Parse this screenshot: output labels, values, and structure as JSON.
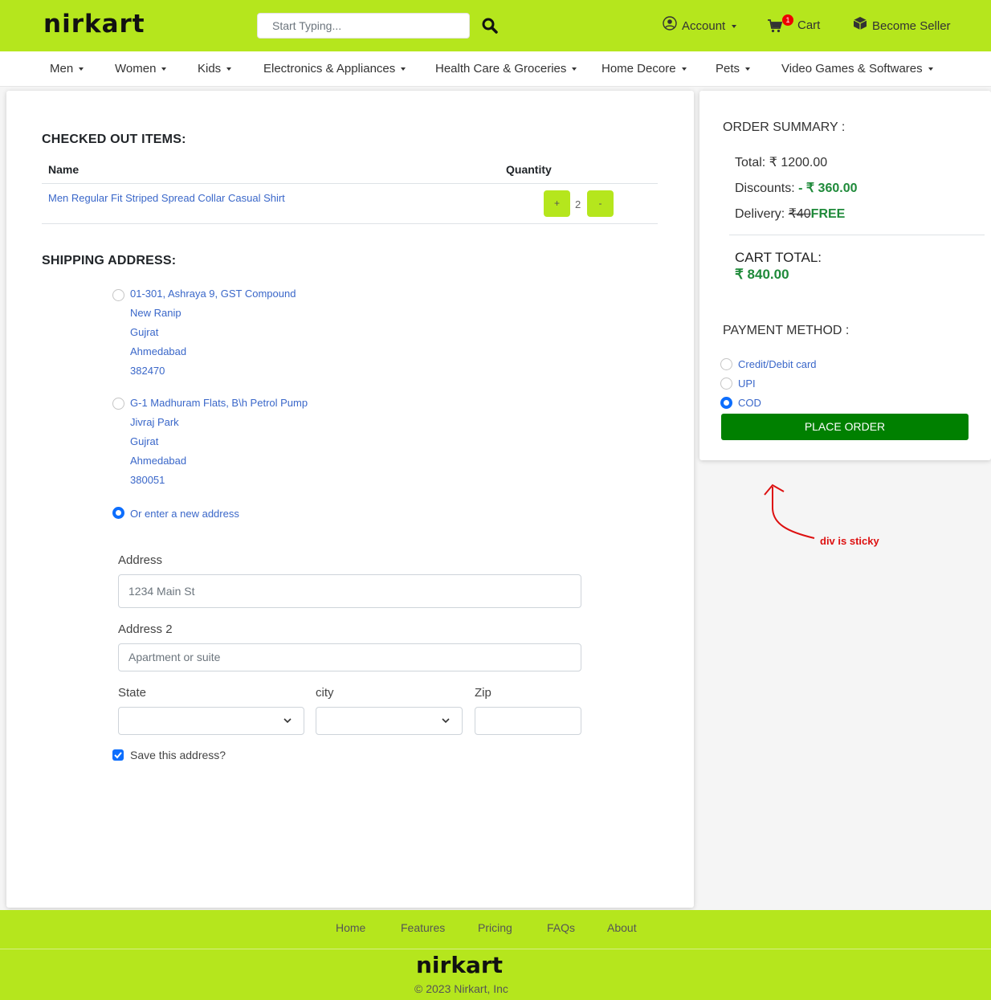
{
  "header": {
    "logo": "nirkart",
    "search_placeholder": "Start Typing...",
    "account_label": "Account",
    "cart_label": "Cart",
    "cart_count": "1",
    "seller_label": "Become Seller"
  },
  "categories": [
    "Men",
    "Women",
    "Kids",
    "Electronics & Appliances",
    "Health Care & Groceries",
    "Home Decore",
    "Pets",
    "Video Games & Softwares"
  ],
  "checkout": {
    "title": "CHECKED OUT ITEMS:",
    "col_name": "Name",
    "col_quantity": "Quantity",
    "items": [
      {
        "name": "Men Regular Fit Striped Spread Collar Casual Shirt",
        "quantity": "2",
        "plus": "+",
        "minus": "-"
      }
    ]
  },
  "shipping": {
    "title": "SHIPPING ADDRESS:",
    "addresses": [
      {
        "line1": "01-301, Ashraya 9, GST Compound",
        "line2": "New Ranip",
        "state": "Gujrat",
        "city": "Ahmedabad",
        "zip": "382470"
      },
      {
        "line1": "G-1 Madhuram Flats, B\\h Petrol Pump",
        "line2": "Jivraj Park",
        "state": "Gujrat",
        "city": "Ahmedabad",
        "zip": "380051"
      }
    ],
    "new_address_label": "Or enter a new address",
    "form": {
      "address_label": "Address",
      "address_placeholder": "1234 Main St",
      "address2_label": "Address 2",
      "address2_placeholder": "Apartment or suite",
      "state_label": "State",
      "city_label": "city",
      "zip_label": "Zip",
      "save_label": "Save this address?"
    }
  },
  "summary": {
    "title": "ORDER SUMMARY :",
    "total_label": "Total:",
    "total_value": "₹ 1200.00",
    "discount_label": "Discounts:",
    "discount_value": "- ₹ 360.00",
    "delivery_label": "Delivery:",
    "delivery_old": "₹40",
    "delivery_new": "FREE",
    "cart_total_label": "CART TOTAL:",
    "cart_total_value": "₹ 840.00",
    "payment_title": "PAYMENT METHOD :",
    "payment_methods": [
      "Credit/Debit card",
      "UPI",
      "COD"
    ],
    "place_order": "PLACE ORDER"
  },
  "annotation": "div is sticky",
  "footer": {
    "links": [
      "Home",
      "Features",
      "Pricing",
      "FAQs",
      "About"
    ],
    "logo": "nirkart",
    "copyright": "© 2023 Nirkart, Inc"
  },
  "colors": {
    "brand": "#b5e61d",
    "accent_link": "#3a67c9",
    "place_order": "#008000",
    "price_green": "#1f8a3a",
    "annotation": "#dd1111"
  }
}
